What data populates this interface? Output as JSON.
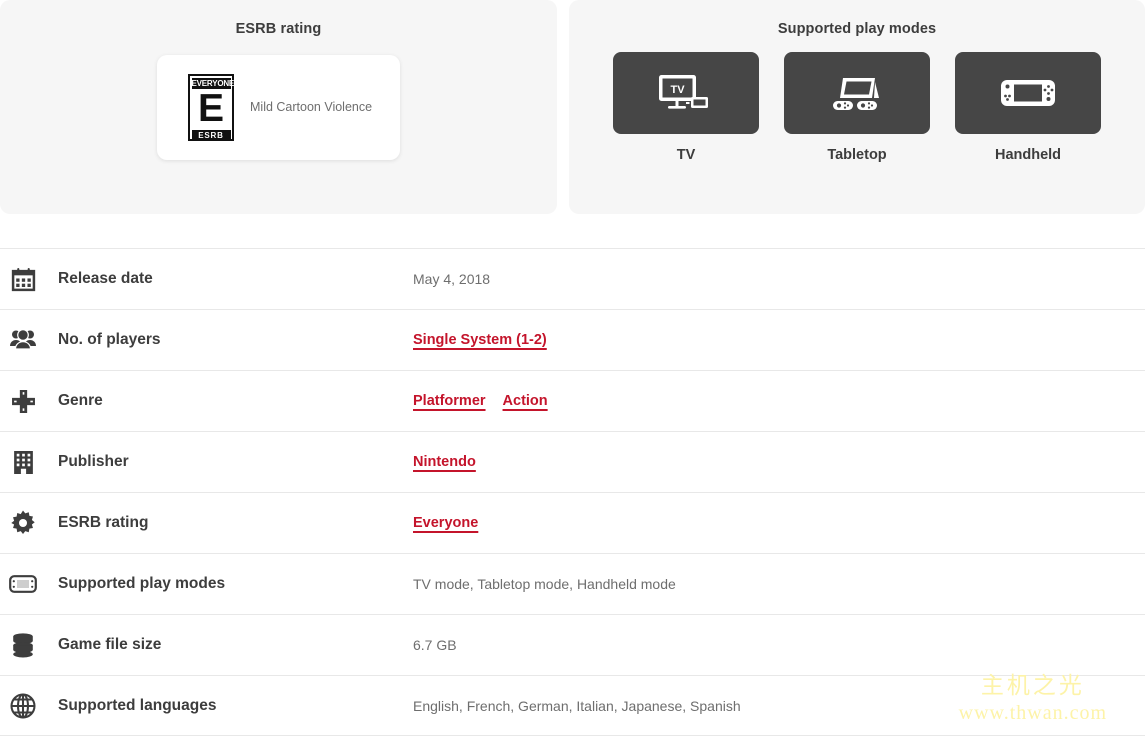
{
  "esrb_panel": {
    "title": "ESRB rating",
    "rating_letter": "E",
    "rating_top_text": "EVERYONE",
    "rating_bottom_text": "ESRB",
    "descriptor": "Mild Cartoon Violence"
  },
  "play_modes_panel": {
    "title": "Supported play modes",
    "modes": [
      {
        "label": "TV",
        "icon": "tv-mode-icon"
      },
      {
        "label": "Tabletop",
        "icon": "tabletop-mode-icon"
      },
      {
        "label": "Handheld",
        "icon": "handheld-mode-icon"
      }
    ]
  },
  "details": {
    "rows": [
      {
        "icon": "calendar-icon",
        "label": "Release date",
        "value": "May 4, 2018",
        "links": []
      },
      {
        "icon": "players-icon",
        "label": "No. of players",
        "value": "",
        "links": [
          "Single System (1-2)"
        ]
      },
      {
        "icon": "dpad-icon",
        "label": "Genre",
        "value": "",
        "links": [
          "Platformer",
          "Action"
        ]
      },
      {
        "icon": "building-icon",
        "label": "Publisher",
        "value": "",
        "links": [
          "Nintendo"
        ]
      },
      {
        "icon": "gear-icon",
        "label": "ESRB rating",
        "value": "",
        "links": [
          "Everyone"
        ]
      },
      {
        "icon": "console-icon",
        "label": "Supported play modes",
        "value": "TV mode, Tabletop mode, Handheld mode",
        "links": []
      },
      {
        "icon": "database-icon",
        "label": "Game file size",
        "value": "6.7 GB",
        "links": []
      },
      {
        "icon": "globe-icon",
        "label": "Supported languages",
        "value": "English, French, German, Italian, Japanese, Spanish",
        "links": []
      }
    ]
  },
  "watermark": {
    "text_cn": "主机之光",
    "text_url": "www.thwan.com"
  },
  "colors": {
    "link_red": "#c4142b",
    "panel_bg": "#f6f6f6",
    "tile_bg": "#464646",
    "text_dark": "#3d3d3d",
    "text_muted": "#6e6e6e",
    "watermark": "#fdf3a8"
  }
}
